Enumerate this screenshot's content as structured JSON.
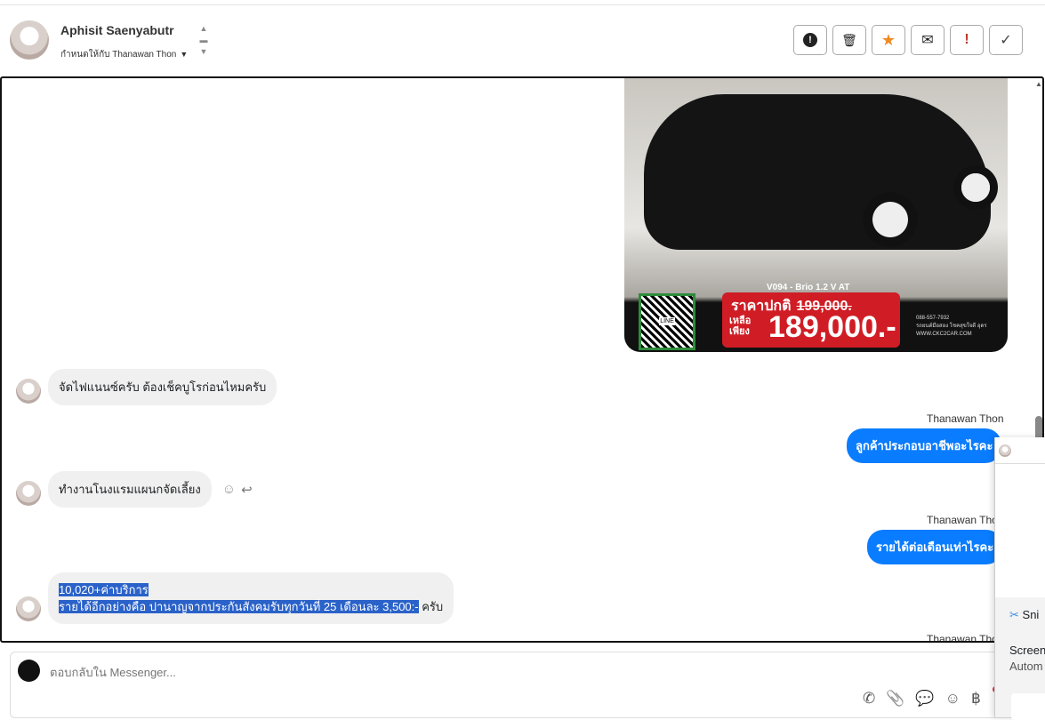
{
  "header": {
    "contact_name": "Aphisit Saenyabutr",
    "assigned_label": "กำหนดให้กับ Thanawan Thon"
  },
  "actions": [
    {
      "name": "spam",
      "glyph": "❗"
    },
    {
      "name": "delete",
      "glyph": "🗑"
    },
    {
      "name": "star",
      "glyph": "★"
    },
    {
      "name": "mark-unread",
      "glyph": "✉"
    },
    {
      "name": "important",
      "glyph": "!"
    },
    {
      "name": "done",
      "glyph": "✓"
    }
  ],
  "car_image": {
    "model": "V094 - Brio 1.2 V AT",
    "regular_label": "ราคาปกติ",
    "regular_price": "199,000.",
    "now_label": "เหลือ เพียง",
    "now_price": "189,000.-",
    "qr_label": "LINE",
    "phone": "088-557-7932",
    "facebook": "รถยนต์มือสอง โชคสุขใจดี อุดร",
    "website": "WWW.CKC2CAR.COM"
  },
  "messages": [
    {
      "from": "contact",
      "text": "จัดไฟแนนซ์ครับ ต้องเช็คบูโรก่อนไหมครับ"
    },
    {
      "from": "agent",
      "sender": "Thanawan Thon",
      "text": "ลูกค้าประกอบอาชีพอะไรคะ"
    },
    {
      "from": "contact",
      "text": "ทำงานโนงแรมแผนกจัดเลี้ยง"
    },
    {
      "from": "agent",
      "sender": "Thanawan Thon",
      "text": "รายได้ต่อเดือนเท่าไรคะ"
    },
    {
      "from": "contact",
      "line1": "10,020+ค่าบริการ",
      "line2": "รายได้อีกอย่างคือ ปานาญจากประกันสังคมรับทุกวันที่ 25 เดือนละ 3,500:-",
      "tail": " ครับ"
    },
    {
      "from": "agent",
      "sender": "Thanawan Thon"
    }
  ],
  "composer": {
    "placeholder": "ตอบกลับใน Messenger..."
  },
  "tools": [
    {
      "name": "call-add",
      "glyph": "✆"
    },
    {
      "name": "attach",
      "glyph": "📎"
    },
    {
      "name": "saved-reply",
      "glyph": "💬"
    },
    {
      "name": "emoji",
      "glyph": "☺"
    },
    {
      "name": "payment",
      "glyph": "฿"
    }
  ],
  "snipping": {
    "app": "Sni",
    "title": "Screen",
    "subtitle": "Autom"
  },
  "colors": {
    "accent": "#0a7cff",
    "selection": "#2a62c9"
  }
}
